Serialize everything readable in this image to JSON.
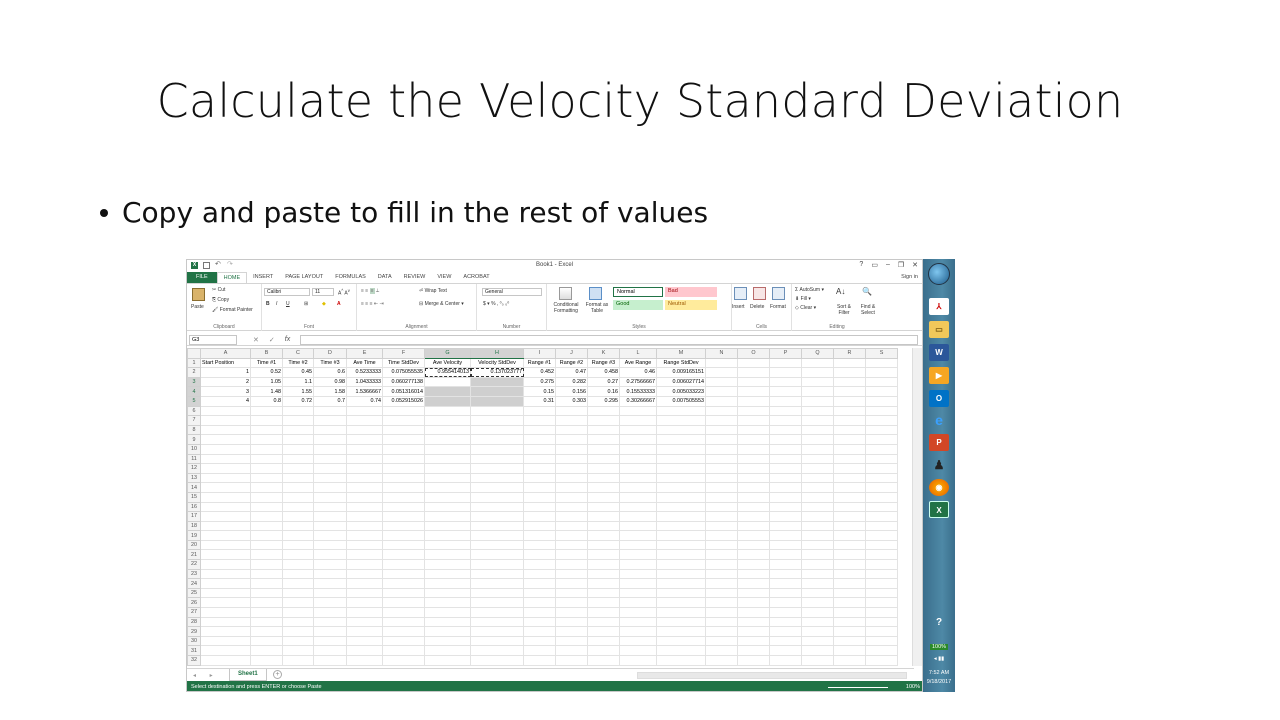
{
  "slide": {
    "title": "Calculate the Velocity Standard Deviation",
    "bullet": "Copy and paste to fill in the rest of values"
  },
  "excel": {
    "window_title": "Book1 - Excel",
    "tabs": [
      "FILE",
      "HOME",
      "INSERT",
      "PAGE LAYOUT",
      "FORMULAS",
      "DATA",
      "REVIEW",
      "VIEW",
      "ACROBAT"
    ],
    "sign_in": "Sign in",
    "ribbon": {
      "clipboard": {
        "paste": "Paste",
        "cut": "Cut",
        "copy": "Copy",
        "format_painter": "Format Painter",
        "name": "Clipboard"
      },
      "font": {
        "family": "Calibri",
        "size": "11",
        "name": "Font"
      },
      "alignment": {
        "wrap": "Wrap Text",
        "merge": "Merge & Center",
        "name": "Alignment"
      },
      "number": {
        "format": "General",
        "name": "Number"
      },
      "styles": {
        "conditional": "Conditional Formatting",
        "format_table": "Format as Table",
        "normal": "Normal",
        "bad": "Bad",
        "good": "Good",
        "neutral": "Neutral",
        "name": "Styles"
      },
      "cells": {
        "insert": "Insert",
        "delete": "Delete",
        "format": "Format",
        "name": "Cells"
      },
      "editing": {
        "autosum": "AutoSum",
        "fill": "Fill",
        "clear": "Clear",
        "sort": "Sort & Filter",
        "find": "Find & Select",
        "name": "Editing"
      }
    },
    "name_box": "G3",
    "formula_fx": "fx",
    "columns": [
      "A",
      "B",
      "C",
      "D",
      "E",
      "F",
      "G",
      "H",
      "I",
      "J",
      "K",
      "L",
      "M",
      "N",
      "O",
      "P",
      "Q",
      "R",
      "S"
    ],
    "rows": [
      [
        "Start Position",
        "Time #1",
        "Time #2",
        "Time #3",
        "Ave Time",
        "Time StdDev",
        "Ave Velocity",
        "Velocity StdDev",
        "Range #1",
        "Range #2",
        "Range #3",
        "Ave Range",
        "Range StdDev",
        "",
        "",
        "",
        "",
        "",
        ""
      ],
      [
        "1",
        "0.52",
        "0.45",
        "0.6",
        "0.5233333",
        "0.075055535",
        "0.955414013",
        "0.137023777",
        "0.452",
        "0.47",
        "0.458",
        "0.46",
        "0.009165151",
        "",
        "",
        "",
        "",
        "",
        ""
      ],
      [
        "2",
        "1.05",
        "1.1",
        "0.98",
        "1.0433333",
        "0.060277138",
        "",
        "",
        "0.275",
        "0.282",
        "0.27",
        "0.27566667",
        "0.006027714",
        "",
        "",
        "",
        "",
        "",
        ""
      ],
      [
        "3",
        "1.48",
        "1.55",
        "1.58",
        "1.5366667",
        "0.051316014",
        "",
        "",
        "0.15",
        "0.156",
        "0.16",
        "0.15533333",
        "0.005033223",
        "",
        "",
        "",
        "",
        "",
        ""
      ],
      [
        "4",
        "0.8",
        "0.72",
        "0.7",
        "0.74",
        "0.052915026",
        "",
        "",
        "0.31",
        "0.303",
        "0.295",
        "0.30266667",
        "0.007505553",
        "",
        "",
        "",
        "",
        "",
        ""
      ]
    ],
    "sheet_tab": "Sheet1",
    "status": "Select destination and press ENTER or choose Paste",
    "zoom": "100%"
  },
  "taskbar": {
    "battery": "100%",
    "time": "7:52 AM",
    "date": "9/18/2017"
  }
}
